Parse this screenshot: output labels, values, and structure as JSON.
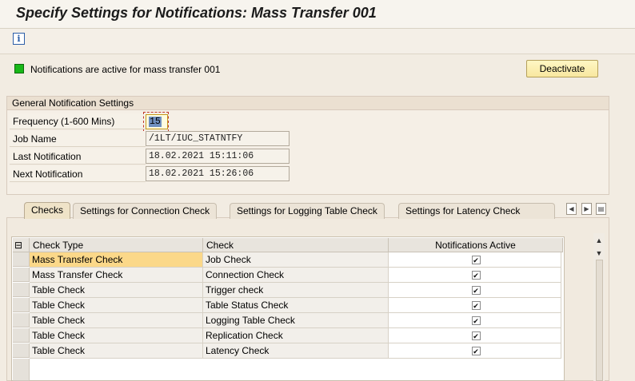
{
  "window": {
    "title": "Specify Settings for Notifications: Mass Transfer 001"
  },
  "toolbar": {
    "info_icon": "info-icon"
  },
  "status": {
    "text": "Notifications are active for mass transfer 001",
    "led_color": "#18b818",
    "deactivate_label": "Deactivate"
  },
  "general": {
    "header": "General Notification Settings",
    "frequency_label": "Frequency (1-600 Mins)",
    "frequency_value": "15",
    "job_name_label": "Job Name",
    "job_name_value": "/1LT/IUC_STATNTFY",
    "last_label": "Last Notification",
    "last_value": "18.02.2021 15:11:06",
    "next_label": "Next Notification",
    "next_value": "18.02.2021 15:26:06"
  },
  "tabs": [
    {
      "label": "Checks"
    },
    {
      "label": "Settings for Connection Check"
    },
    {
      "label": "Settings for Logging Table Check"
    },
    {
      "label": "Settings for Latency Check"
    }
  ],
  "table": {
    "columns": [
      "Check Type",
      "Check",
      "Notifications Active"
    ],
    "rows": [
      {
        "type": "Mass Transfer Check",
        "check": "Job Check",
        "active": true
      },
      {
        "type": "Mass Transfer Check",
        "check": "Connection Check",
        "active": true
      },
      {
        "type": "Table Check",
        "check": "Trigger check",
        "active": true
      },
      {
        "type": "Table Check",
        "check": "Table Status Check",
        "active": true
      },
      {
        "type": "Table Check",
        "check": "Logging Table Check",
        "active": true
      },
      {
        "type": "Table Check",
        "check": "Replication Check",
        "active": true
      },
      {
        "type": "Table Check",
        "check": "Latency Check",
        "active": true
      }
    ]
  },
  "colors": {
    "accent": "#fbd889",
    "button": "#f8e7a0"
  }
}
